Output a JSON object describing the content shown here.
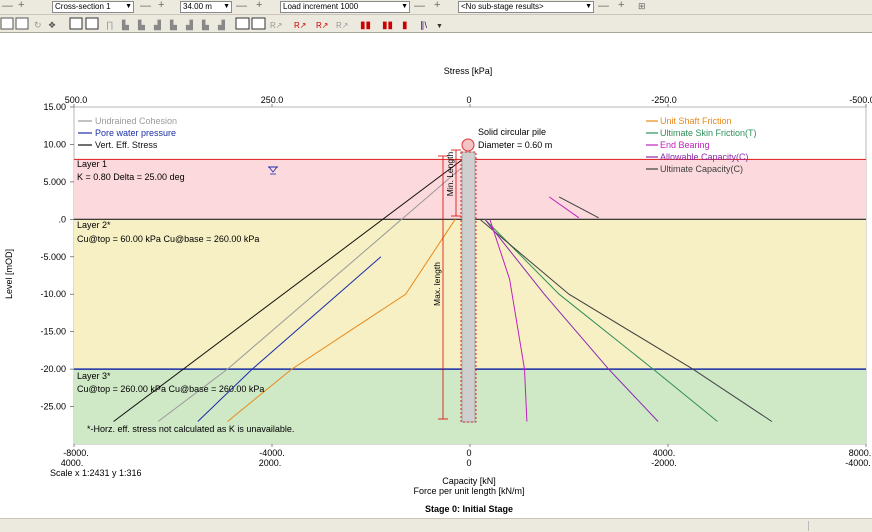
{
  "toolbar": {
    "cross_section": "Cross-section 1",
    "length_value": "34.00 m",
    "load_increment": "Load increment 1000",
    "substage": "<No sub-stage results>"
  },
  "chart_data": {
    "type": "line",
    "title": "Stage 0: Initial Stage",
    "top_axis_label": "Stress [kPa]",
    "top_ticks": [
      "500.0",
      "250.0",
      "0",
      "-250.0",
      "-500.0"
    ],
    "ylabel": "Level [mOD]",
    "yticks": [
      "15.00",
      "10.00",
      "5.000",
      ".0",
      "-5.000",
      "-10.00",
      "-15.00",
      "-20.00",
      "-25.00"
    ],
    "ylim": [
      -30,
      15
    ],
    "bottom_ticks_row1": [
      "-8000.",
      "-4000.",
      "0",
      "4000.",
      "8000."
    ],
    "bottom_ticks_row2": [
      "4000.",
      "2000.",
      "0",
      "-2000.",
      "-4000."
    ],
    "xlabel1": "Capacity [kN]",
    "xlabel2": "Force per unit length [kN/m]",
    "scale_text": "Scale x 1:2431  y 1:316",
    "capacity_xlim": [
      -8000,
      8000
    ],
    "legend_left": [
      {
        "name": "Undrained Cohesion",
        "color": "#9a9a9a"
      },
      {
        "name": "Pore water pressure",
        "color": "#1a2ea8"
      },
      {
        "name": "Vert. Eff. Stress",
        "color": "#111111"
      }
    ],
    "legend_right": [
      {
        "name": "Unit Shaft Friction",
        "color": "#e8891a"
      },
      {
        "name": "Ultimate Skin Friction(T)",
        "color": "#2f8f5a"
      },
      {
        "name": "End Bearing",
        "color": "#c020c0"
      },
      {
        "name": "Allowable Capacity(C)",
        "color": "#8a2ab0"
      },
      {
        "name": "Ultimate Capacity(C)",
        "color": "#404040"
      }
    ],
    "layers": [
      {
        "name": "Layer 1",
        "desc": "K = 0.80 Delta = 25.00 deg",
        "top": 8.0,
        "bottom": 0.0,
        "color": "#fbd9dc"
      },
      {
        "name": "Layer 2*",
        "desc": "Cu@top = 60.00 kPa Cu@base = 260.00 kPa",
        "top": 0.0,
        "bottom": -20.0,
        "color": "#f6f0c4"
      },
      {
        "name": "Layer 3*",
        "desc": "Cu@top = 260.00 kPa Cu@base = 260.00 kPa",
        "top": -20.0,
        "bottom": -30.0,
        "color": "#cfe8c6"
      }
    ],
    "pile_label": "Solid circular pile",
    "pile_diameter": "Diameter = 0.60 m",
    "min_length": "Min. Length",
    "max_length": "Max. length",
    "note": "*-Horz. eff. stress not calculated as K is unavailable.",
    "series": [
      {
        "name": "Vert. Eff. Stress",
        "color": "#111111",
        "points": [
          [
            -7200,
            -27
          ],
          [
            -150,
            8
          ]
        ]
      },
      {
        "name": "Undrained Cohesion",
        "color": "#9a9a9a",
        "points": [
          [
            -6300,
            -27
          ],
          [
            -4900,
            -20
          ],
          [
            -150,
            7
          ]
        ]
      },
      {
        "name": "Pore water pressure",
        "color": "#1a2ea8",
        "points": [
          [
            -5500,
            -27
          ],
          [
            -4400,
            -20
          ],
          [
            -1800,
            -5
          ]
        ]
      },
      {
        "name": "Unit Shaft Friction",
        "color": "#e8891a",
        "points": [
          [
            -4900,
            -27
          ],
          [
            -3600,
            -20
          ],
          [
            -1300,
            -10
          ],
          [
            -300,
            0
          ]
        ]
      },
      {
        "name": "Ultimate Skin Friction(T)",
        "color": "#2f8f5a",
        "points": [
          [
            300,
            0
          ],
          [
            1800,
            -10
          ],
          [
            3700,
            -20
          ],
          [
            5000,
            -27
          ]
        ]
      },
      {
        "name": "Ultimate Capacity(C)",
        "color": "#404040",
        "points": [
          [
            200,
            0
          ],
          [
            2000,
            -10
          ],
          [
            4500,
            -20
          ],
          [
            6100,
            -27
          ]
        ]
      },
      {
        "name": "Allowable Capacity(C)",
        "color": "#8a2ab0",
        "points": [
          [
            300,
            0
          ],
          [
            1500,
            -10
          ],
          [
            2800,
            -20
          ],
          [
            3800,
            -27
          ]
        ]
      },
      {
        "name": "End Bearing",
        "color": "#c020c0",
        "points": [
          [
            400,
            0
          ],
          [
            800,
            -8
          ],
          [
            1100,
            -20
          ],
          [
            1150,
            -27
          ]
        ]
      },
      {
        "name": "Ultimate Capacity(C) layer1",
        "color": "#404040",
        "points": [
          [
            1800,
            3
          ],
          [
            2600,
            0.2
          ]
        ]
      },
      {
        "name": "End Bearing layer1",
        "color": "#c020c0",
        "points": [
          [
            1600,
            3
          ],
          [
            2200,
            0.2
          ]
        ]
      }
    ]
  }
}
